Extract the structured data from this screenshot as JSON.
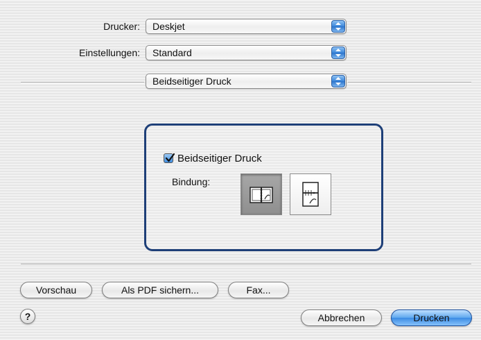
{
  "printer": {
    "label": "Drucker:",
    "value": "Deskjet"
  },
  "presets": {
    "label": "Einstellungen:",
    "value": "Standard"
  },
  "panel_menu": {
    "value": "Beidseitiger Druck"
  },
  "duplex": {
    "checkbox_label": "Beidseitiger Druck",
    "checked": true,
    "binding_label": "Bindung:",
    "binding_options": [
      {
        "icon": "long-edge-binding-icon",
        "selected": true
      },
      {
        "icon": "short-edge-binding-icon",
        "selected": false
      }
    ]
  },
  "buttons": {
    "preview": "Vorschau",
    "save_pdf": "Als PDF sichern...",
    "fax": "Fax...",
    "cancel": "Abbrechen",
    "print": "Drucken",
    "help": "?"
  },
  "colors": {
    "group_border": "#1e3f78",
    "accent": "#3b8be3"
  }
}
